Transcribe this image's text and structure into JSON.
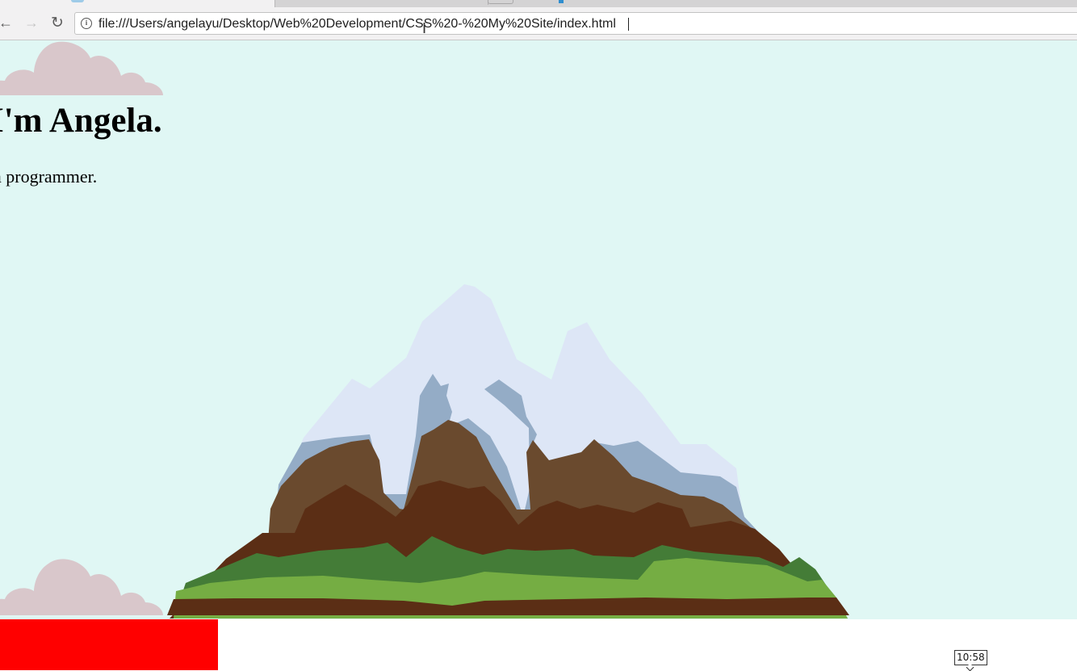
{
  "browser": {
    "address_bar": {
      "url": "file:///Users/angelayu/Desktop/Web%20Development/CSS%20-%20My%20Site/index.html"
    },
    "icons": {
      "back": "arrow-left-icon",
      "forward": "arrow-right-icon",
      "reload": "reload-icon",
      "site_info": "info-icon"
    }
  },
  "page": {
    "heading": "I'm Angela.",
    "subheading": "a programmer.",
    "colors": {
      "background": "#e0f7f4",
      "cloud": "#d9c7cb",
      "red_block": "#ff0000",
      "snow": "#dde6f6",
      "shadow_blue": "#94acc6",
      "rock_light": "#6a4a2e",
      "rock_dark": "#5b2e15",
      "grass_dark": "#447c37",
      "grass_light": "#75ad43"
    }
  },
  "overlay": {
    "timestamp": "10:58"
  }
}
